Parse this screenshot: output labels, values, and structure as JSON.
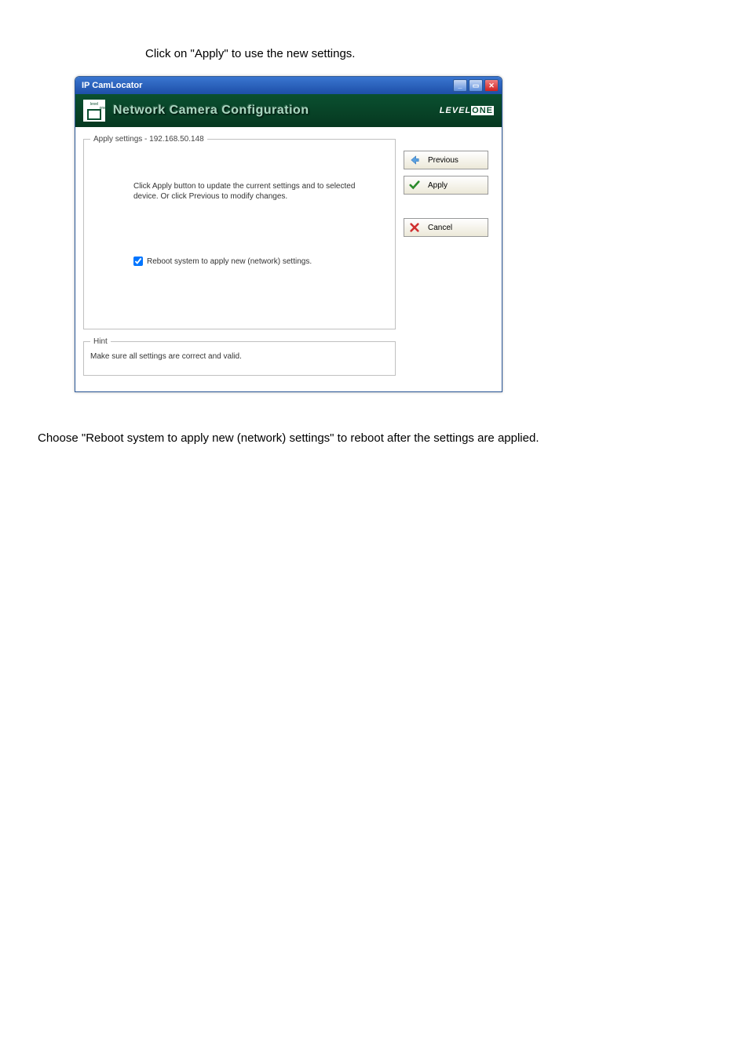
{
  "page": {
    "intro": "Click on \"Apply\" to use the new settings.",
    "outro": "Choose \"Reboot system to apply new (network) settings\" to reboot after the settings are applied."
  },
  "window": {
    "title": "IP CamLocator",
    "header": {
      "title": "Network Camera Configuration",
      "brand_prefix": "LEVEL",
      "brand_suffix": "ONE",
      "logo_top": "level",
      "logo_bottom": "one"
    },
    "apply_section": {
      "legend": "Apply settings - 192.168.50.148",
      "text": "Click Apply button to update the current settings and to selected device. Or click Previous to modify changes.",
      "checkbox_label": "Reboot system to apply  new (network) settings.",
      "checkbox_checked": true
    },
    "hint_section": {
      "legend": "Hint",
      "text": "Make sure all settings are correct and valid."
    },
    "buttons": {
      "previous": "Previous",
      "apply": "Apply",
      "cancel": "Cancel"
    }
  }
}
